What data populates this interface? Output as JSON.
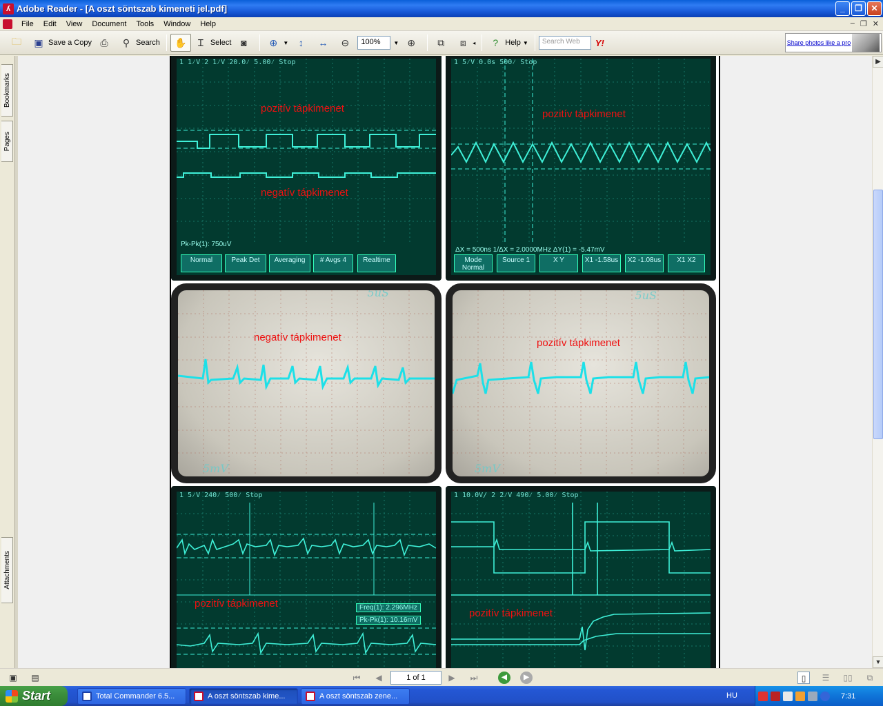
{
  "window": {
    "title": "Adobe Reader - [A oszt söntszab kimeneti jel.pdf]",
    "app_icon": "acrobat-icon"
  },
  "menu": [
    "File",
    "Edit",
    "View",
    "Document",
    "Tools",
    "Window",
    "Help"
  ],
  "toolbar": {
    "save_copy_label": "Save a Copy",
    "search_label": "Search",
    "select_label": "Select",
    "zoom_value": "100%",
    "help_label": "Help",
    "search_web_placeholder": "Search Web",
    "ad_text": "Share photos like a pro"
  },
  "nav_tabs": {
    "bookmarks": "Bookmarks",
    "pages": "Pages",
    "attachments": "Attachments"
  },
  "document": {
    "scopes": [
      {
        "id": "top-left",
        "header": "1  1⁄V   2  1⁄V          20.0⁄   5.00⁄   Stop",
        "labels": [
          "pozitív tápkimenet",
          "negatív tápkimenet"
        ],
        "footer": "Pk-Pk(1): 750uV",
        "softkeys": [
          "Normal",
          "Peak Det",
          "Averaging",
          "# Avgs 4",
          "Realtime"
        ]
      },
      {
        "id": "top-right",
        "header": "1  5⁄V                    0.0s   500⁄   Stop",
        "labels": [
          "pozitív tápkimenet"
        ],
        "footer": "ΔX = 500ns      1/ΔX = 2.0000MHz      ΔY(1) = -5.47mV",
        "softkeys": [
          "Mode Normal",
          "Source 1",
          "X  Y",
          "X1 -1.58us",
          "X2 -1.08us",
          "X1 X2"
        ]
      },
      {
        "id": "mid-left",
        "labels": [
          "negatív tápkimenet"
        ],
        "marks": [
          "5uS",
          "5mV"
        ]
      },
      {
        "id": "mid-right",
        "labels": [
          "pozitív tápkimenet"
        ],
        "marks": [
          "5uS",
          "5mV"
        ]
      },
      {
        "id": "bottom-left",
        "header": "1  5⁄V               240⁄   500⁄   Stop",
        "labels": [
          "pozitív tápkimenet"
        ],
        "readouts": [
          "Freq(1): 2.296MHz",
          "Pk-Pk(1): 10.16mV"
        ]
      },
      {
        "id": "bottom-right",
        "header": "1 10.0V/  2  2⁄V         490⁄   5.00⁄   Stop",
        "labels": [
          "pozitív tápkimenet"
        ]
      }
    ]
  },
  "status": {
    "page_indicator": "1 of 1"
  },
  "taskbar": {
    "start_label": "Start",
    "tasks": [
      {
        "label": "Total Commander 6.5...",
        "icon": "total-commander-icon",
        "active": false
      },
      {
        "label": "A oszt söntszab kime...",
        "icon": "pdf-icon",
        "active": true
      },
      {
        "label": "A oszt söntszab zene...",
        "icon": "pdf-icon",
        "active": false
      }
    ],
    "language": "HU",
    "clock": "7:31"
  },
  "colors": {
    "scope_trace": "#3ff0d8",
    "scope_bg": "#023a2f",
    "label_red": "#e11111"
  }
}
